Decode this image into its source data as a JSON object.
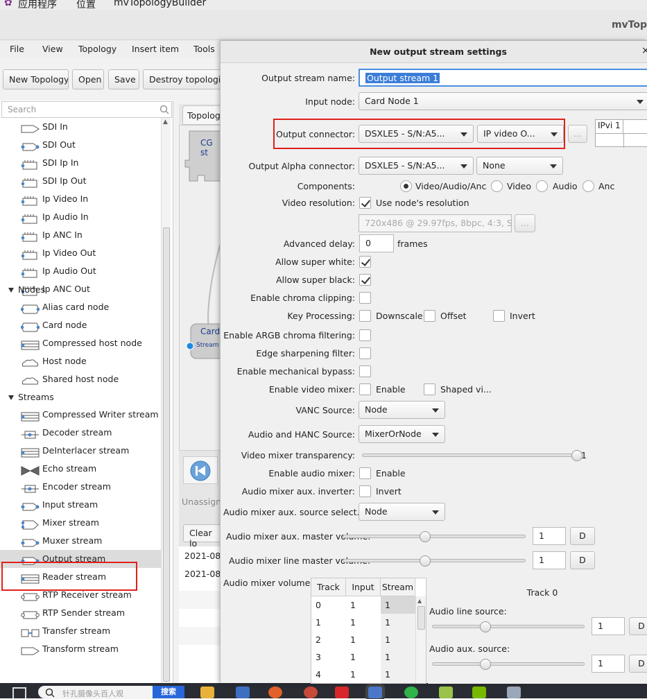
{
  "system_bar": {
    "apps": "应用程序",
    "places": "位置",
    "app_name": "mvTopologyBuilder"
  },
  "window_title": "mvTop",
  "menu": [
    "File",
    "View",
    "Topology",
    "Insert item",
    "Tools"
  ],
  "toolbar": [
    "New Topology",
    "Open",
    "Save",
    "Destroy topologies"
  ],
  "search": {
    "placeholder": "Search"
  },
  "tree": {
    "connectors": [
      "SDI In",
      "SDI Out",
      "SDI Ip In",
      "SDI Ip Out",
      "Ip Video In",
      "Ip Audio In",
      "Ip ANC In",
      "Ip Video Out",
      "Ip Audio Out",
      "Ip ANC Out"
    ],
    "nodes_label": "Nodes",
    "nodes": [
      "Alias card node",
      "Card node",
      "Compressed host node",
      "Host node",
      "Shared host node"
    ],
    "streams_label": "Streams",
    "streams": [
      "Compressed Writer stream",
      "Decoder stream",
      "DeInterlacer stream",
      "Echo stream",
      "Encoder stream",
      "Input stream",
      "Mixer stream",
      "Muxer stream",
      "Output stream",
      "Reader stream",
      "RTP Receiver stream",
      "RTP Sender stream",
      "Transfer stream",
      "Transform stream"
    ]
  },
  "middle": {
    "tab": "Topology",
    "cg_label": "CG st",
    "card_label": "Card",
    "stream_label": "Stream",
    "unassigned": "Unassigne",
    "clear_log": "Clear lo",
    "log": [
      "2021-08",
      "2021-08"
    ]
  },
  "dialog": {
    "title": "New output stream settings",
    "close": "×",
    "output_stream_name": {
      "label": "Output stream name:",
      "value": "Output stream 1"
    },
    "input_node": {
      "label": "Input node:",
      "value": "Card Node 1"
    },
    "output_connector": {
      "label": "Output connector:",
      "device": "DSXLE5 - S/N:A5...",
      "port": "IP video O...",
      "more": "..."
    },
    "ipvi_table": [
      "IPvi 1"
    ],
    "output_alpha": {
      "label": "Output Alpha connector:",
      "device": "DSXLE5 - S/N:A5...",
      "port": "None"
    },
    "components": {
      "label": "Components:",
      "options": [
        "Video/Audio/Anc",
        "Video",
        "Audio",
        "Anc"
      ],
      "selected": "Video/Audio/Anc"
    },
    "video_resolution": {
      "label": "Video resolution:",
      "checkbox": "Use node's resolution",
      "checked": true,
      "value": "720x486 @ 29.97fps, 8bpc, 4:3, S",
      "more": "..."
    },
    "advanced_delay": {
      "label": "Advanced delay:",
      "value": "0",
      "unit": "frames"
    },
    "allow_super_white": {
      "label": "Allow super white:",
      "checked": true
    },
    "allow_super_black": {
      "label": "Allow super black:",
      "checked": true
    },
    "enable_chroma_clipping": {
      "label": "Enable chroma clipping:",
      "checked": false
    },
    "key_processing": {
      "label": "Key Processing:",
      "options": [
        "Downscale",
        "Offset",
        "Invert"
      ]
    },
    "enable_argb": {
      "label": "Enable ARGB chroma filtering:",
      "checked": false
    },
    "edge_sharpening": {
      "label": "Edge sharpening filter:",
      "checked": false
    },
    "mechanical_bypass": {
      "label": "Enable mechanical bypass:",
      "checked": false
    },
    "video_mixer": {
      "label": "Enable video mixer:",
      "enable": "Enable",
      "shaped": "Shaped vi..."
    },
    "vanc_source": {
      "label": "VANC Source:",
      "value": "Node"
    },
    "audio_hanc_source": {
      "label": "Audio and HANC Source:",
      "value": "MixerOrNode"
    },
    "video_mixer_transparency": {
      "label": "Video mixer transparency:",
      "value": "1",
      "level": 1.0
    },
    "enable_audio_mixer": {
      "label": "Enable audio mixer:",
      "checkbox": "Enable"
    },
    "audio_aux_inverter": {
      "label": "Audio mixer aux. inverter:",
      "checkbox": "Invert"
    },
    "audio_aux_source": {
      "label": "Audio mixer aux. source select...",
      "value": "Node"
    },
    "aux_master_volume": {
      "label": "Audio mixer aux. master volume:",
      "value": "1",
      "button": "D",
      "level": 0.45
    },
    "line_master_volume": {
      "label": "Audio mixer line master volume:",
      "value": "1",
      "button": "D",
      "level": 0.45
    },
    "mixer_volumes": {
      "label": "Audio mixer volumes:",
      "columns": [
        "Track",
        "Input",
        "Stream"
      ],
      "rows": [
        [
          "0",
          "1",
          "1"
        ],
        [
          "1",
          "1",
          "1"
        ],
        [
          "2",
          "1",
          "1"
        ],
        [
          "3",
          "1",
          "1"
        ],
        [
          "4",
          "1",
          "1"
        ]
      ]
    },
    "track_panel": {
      "title": "Track 0",
      "line_source": {
        "label": "Audio line source:",
        "value": "1",
        "button": "D",
        "level": 0.35
      },
      "aux_source": {
        "label": "Audio aux. source:",
        "value": "1",
        "button": "D",
        "level": 0.35
      }
    }
  },
  "taskbar": {
    "search_placeholder": "针孔摄像头百人观",
    "search_button": "搜索"
  }
}
